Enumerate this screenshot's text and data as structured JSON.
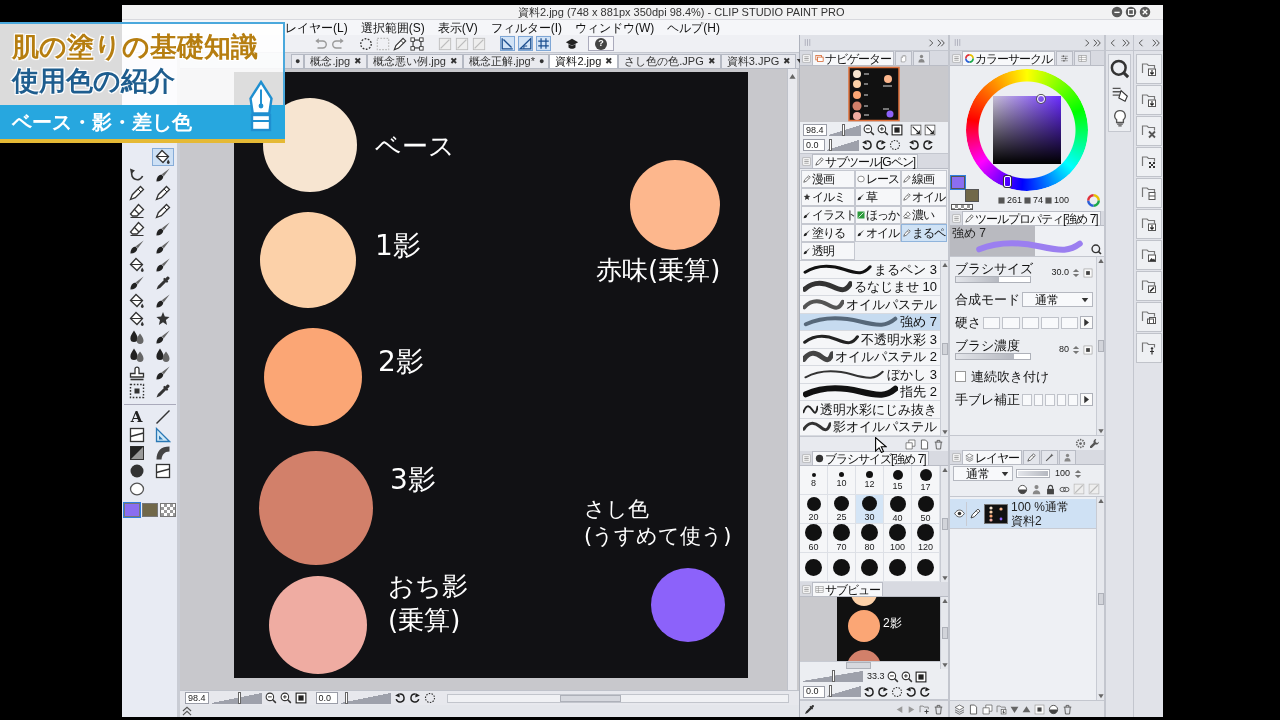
{
  "banner": {
    "title": "肌の塗りの基礎知識",
    "subtitle": "使用色の紹介",
    "tagline": "ベース・影・差し色"
  },
  "window": {
    "title": "資料2.jpg (748 x 881px 350dpi 98.4%) - CLIP STUDIO PAINT PRO"
  },
  "menu": [
    "レイヤー(L)",
    "選択範囲(S)",
    "表示(V)",
    "フィルター(I)",
    "ウィンドウ(W)",
    "ヘルプ(H)"
  ],
  "toolbar": {
    "toggles": [
      {
        "on": true
      },
      {
        "on": true
      },
      {
        "on": true
      }
    ],
    "help": "?"
  },
  "tool_groups": [
    {
      "tools": [
        {
          "selected": true
        },
        {
          "selected": false
        },
        {
          "selected": false
        },
        {
          "selected": false
        },
        {
          "selected": false
        },
        {
          "selected": false
        },
        {
          "selected": false
        },
        {
          "selected": false
        },
        {
          "selected": false
        },
        {
          "selected": false
        },
        {
          "selected": false
        },
        {
          "selected": false
        },
        {
          "selected": false
        },
        {
          "selected": false
        },
        {
          "selected": false
        },
        {
          "selected": false
        },
        {
          "selected": false
        },
        {
          "selected": false
        },
        {
          "selected": false
        },
        {
          "selected": false
        },
        {
          "selected": false
        },
        {
          "selected": false
        },
        {
          "selected": false
        },
        {
          "selected": false
        },
        {
          "selected": false
        },
        {
          "selected": false
        },
        {
          "selected": false
        }
      ]
    },
    {
      "tools": [
        {
          "glyph": "A",
          "selected": false
        },
        {
          "selected": false
        },
        {
          "selected": false
        },
        {
          "selected": false
        },
        {
          "selected": false
        },
        {
          "selected": false
        },
        {
          "selected": false
        },
        {
          "selected": false
        },
        {
          "selected": false
        }
      ]
    }
  ],
  "tool_colors": [
    {
      "kind": "solid",
      "color": "#8b6ef0",
      "selected": true
    },
    {
      "kind": "solid",
      "color": "#716849",
      "selected": false
    },
    {
      "kind": "transparent",
      "selected": false
    }
  ],
  "tabs": [
    {
      "close": "●",
      "selected": false
    },
    {
      "label": "概念.jpg",
      "close": "✖",
      "selected": false
    },
    {
      "label": "概念悪い例.jpg",
      "close": "✖",
      "selected": false
    },
    {
      "label": "概念正解.jpg*",
      "close": "●",
      "selected": false
    },
    {
      "label": "資料2.jpg",
      "close": "✖",
      "selected": true
    },
    {
      "label": "さし色の色.JPG",
      "close": "✖",
      "selected": false
    },
    {
      "label": "資料3.JPG",
      "close": "✖",
      "selected": false
    }
  ],
  "canvas": {
    "swatches": [
      {
        "color": "#f7e5d1",
        "labels": [
          "ベース"
        ]
      },
      {
        "color": "#fcd1a9",
        "labels": [
          "1影"
        ]
      },
      {
        "color": "#fba675",
        "labels": [
          "2影"
        ]
      },
      {
        "color": "#d2806a",
        "labels": [
          "3影"
        ]
      },
      {
        "color": "#efaca2",
        "labels": [
          "おち影",
          "(乗算)"
        ]
      },
      {
        "color": "#fdb78d",
        "labels": [
          "赤味(乗算)"
        ]
      },
      {
        "color": "#8c62fa",
        "labels": [
          "さし色",
          "(うすめて使う)"
        ]
      }
    ]
  },
  "status_bar": {
    "zoom": "98.4",
    "zoom_slider": {
      "level": 0.55
    },
    "angle": "0.0",
    "angle_slider": {
      "level": 0.1
    }
  },
  "navigator": {
    "tabs": [
      {
        "label": "ナビゲーター",
        "selected": true
      },
      {
        "selected": false
      },
      {
        "selected": false
      }
    ],
    "zoom": "98.4",
    "zoom_slider": {
      "level": 0.45
    },
    "angle": "0.0",
    "angle_slider": {
      "level": 0.1
    }
  },
  "subtool": {
    "tabs": [
      {
        "label": "サブツール[Gペン]",
        "selected": true
      }
    ],
    "buttons": [
      {
        "label": "漫画",
        "selected": false
      },
      {
        "label": "レース",
        "selected": false
      },
      {
        "label": "線画",
        "selected": false
      },
      {
        "label": "イルミ",
        "selected": false
      },
      {
        "label": "草",
        "selected": false
      },
      {
        "label": "オイル",
        "selected": false
      },
      {
        "label": "イラスト",
        "selected": false
      },
      {
        "label": "ほっか",
        "selected": false
      },
      {
        "label": "濃い",
        "selected": false
      },
      {
        "label": "塗りる",
        "selected": false
      },
      {
        "label": "オイル",
        "selected": false
      },
      {
        "label": "まるペ",
        "selected": true
      },
      {
        "label": "透明",
        "selected": false
      }
    ],
    "brushes": [
      {
        "label": "まるペン 3",
        "selected": false
      },
      {
        "label": "るなじませ 10",
        "selected": false
      },
      {
        "label": "オイルパステル",
        "selected": false
      },
      {
        "label": "強め 7",
        "selected": true
      },
      {
        "label": "不透明水彩 3",
        "selected": false
      },
      {
        "label": "オイルパステル 2",
        "selected": false
      },
      {
        "label": "ぼかし 3",
        "selected": false
      },
      {
        "label": "指先 2",
        "selected": false
      },
      {
        "label": "透明水彩にじみ抜き",
        "selected": false
      },
      {
        "label": "影オイルパステル",
        "selected": false
      }
    ]
  },
  "brush_size": {
    "tabs": [
      {
        "label": "ブラシサイズ[強め 7]",
        "selected": true
      }
    ],
    "sizes": [
      {
        "label": "8",
        "selected": false
      },
      {
        "label": "10",
        "selected": false
      },
      {
        "label": "12",
        "selected": false
      },
      {
        "label": "15",
        "selected": false
      },
      {
        "label": "17",
        "selected": false
      },
      {
        "label": "20",
        "selected": false
      },
      {
        "label": "25",
        "selected": false
      },
      {
        "label": "30",
        "selected": true
      },
      {
        "label": "40",
        "selected": false
      },
      {
        "label": "50",
        "selected": false
      },
      {
        "label": "60",
        "selected": false
      },
      {
        "label": "70",
        "selected": false
      },
      {
        "label": "80",
        "selected": false
      },
      {
        "label": "100",
        "selected": false
      },
      {
        "label": "120",
        "selected": false
      },
      {
        "selected": false
      },
      {
        "selected": false
      },
      {
        "selected": false
      },
      {
        "selected": false
      },
      {
        "selected": false
      }
    ]
  },
  "subview": {
    "tabs": [
      {
        "label": "サブビュー",
        "selected": true
      }
    ],
    "preview_label": "2影",
    "zoom": "33.3",
    "zoom_slider": {
      "level": 0.5
    },
    "angle": "0.0",
    "angle_slider": {
      "level": 0.1
    }
  },
  "color": {
    "tabs": [
      {
        "label": "カラーサークル",
        "selected": true
      },
      {
        "selected": false
      },
      {
        "selected": false
      }
    ],
    "chips": [
      {
        "kind": "solid",
        "color": "#8b6ef0",
        "selected": true
      },
      {
        "kind": "solid",
        "color": "#716849",
        "selected": false
      },
      {
        "kind": "transparent",
        "selected": false
      }
    ],
    "hue": "261",
    "saturation": "74",
    "value": "100"
  },
  "tool_property": {
    "tabs": [
      {
        "label": "ツールプロパティ[強め 7]",
        "selected": true
      }
    ],
    "preview_label": "強め 7",
    "rows": [
      {
        "kind": "slider",
        "label": "ブラシサイズ",
        "value": "30.0",
        "level": 0.58
      },
      {
        "kind": "dropdown",
        "label": "合成モード",
        "value": "通常"
      },
      {
        "kind": "segments",
        "label": "硬さ"
      },
      {
        "kind": "slider",
        "label": "ブラシ濃度",
        "value": "80",
        "level": 0.78
      },
      {
        "kind": "checkbox",
        "label": "連続吹き付け",
        "checked": false
      },
      {
        "kind": "segments",
        "label": "手ブレ補正"
      }
    ]
  },
  "layer": {
    "tabs": [
      {
        "label": "レイヤー",
        "selected": true
      },
      {
        "selected": false
      },
      {
        "selected": false
      },
      {
        "selected": false
      }
    ],
    "blend": "通常",
    "opacity_slider": {
      "level": 1
    },
    "opacity": "100",
    "layers": [
      {
        "visible": true,
        "mode": "100 %通常",
        "name": "資料2",
        "selected": true
      }
    ]
  }
}
